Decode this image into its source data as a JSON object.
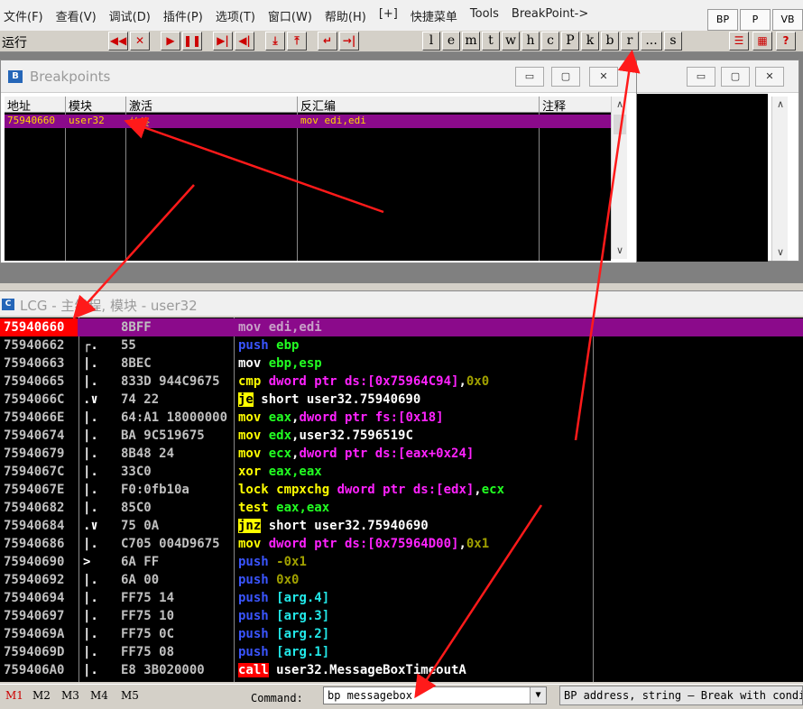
{
  "menu": [
    "文件(F)",
    "查看(V)",
    "调试(D)",
    "插件(P)",
    "选项(T)",
    "窗口(W)",
    "帮助(H)",
    "[+]",
    "快捷菜单",
    "Tools",
    "BreakPoint->"
  ],
  "top_buttons": [
    "BP",
    "P",
    "VB"
  ],
  "toolbar": {
    "status": "运行",
    "buttons": [
      "◀◀",
      "✕",
      "▶",
      "❚❚",
      "▶|",
      "◀|",
      "⤓",
      "⤒",
      "↵",
      "→|"
    ],
    "letters": [
      "l",
      "e",
      "m",
      "t",
      "w",
      "h",
      "c",
      "P",
      "k",
      "b",
      "r",
      "...",
      "s"
    ],
    "extra": [
      "☰",
      "▦",
      "?"
    ]
  },
  "breakpoints_window": {
    "title": "Breakpoints",
    "columns": [
      "地址",
      "模块",
      "激活",
      "反汇编",
      "注释"
    ],
    "rows": [
      {
        "address": "75940660",
        "module": "user32",
        "active": "始终",
        "disasm": "mov edi,edi",
        "comment": ""
      }
    ]
  },
  "cpu_window": {
    "title": "LCG - 主线程, 模块 - user32",
    "rows": [
      {
        "addr": "75940660",
        "mark": "",
        "hex": "8BFF",
        "parts": [
          {
            "t": "mov edi,edi",
            "c": "#ffffff"
          }
        ]
      },
      {
        "addr": "75940662",
        "mark": "┌.",
        "hex": "55",
        "parts": [
          {
            "t": "push ",
            "c": "#3a55ff"
          },
          {
            "t": "ebp",
            "c": "#22ff22"
          }
        ]
      },
      {
        "addr": "75940663",
        "mark": "|.",
        "hex": "8BEC",
        "parts": [
          {
            "t": "mov ",
            "c": "#ffffff"
          },
          {
            "t": "ebp,esp",
            "c": "#22ff22"
          }
        ]
      },
      {
        "addr": "75940665",
        "mark": "|.",
        "hex": "833D 944C9675",
        "parts": [
          {
            "t": "cmp ",
            "c": "#ffff00"
          },
          {
            "t": "dword ptr ds:[0x75964C94]",
            "c": "#ff22ff"
          },
          {
            "t": ",",
            "c": "#ffffff"
          },
          {
            "t": "0x0",
            "c": "#a0a000"
          }
        ]
      },
      {
        "addr": "7594066C",
        "mark": ".∨",
        "hex": "74 22",
        "parts": [
          {
            "t": "je",
            "c": "#000000",
            "bg": "#ffff00"
          },
          {
            "t": " short user32.75940690",
            "c": "#ffffff"
          }
        ]
      },
      {
        "addr": "7594066E",
        "mark": "|.",
        "hex": "64:A1 18000000",
        "parts": [
          {
            "t": "mov ",
            "c": "#ffff00"
          },
          {
            "t": "eax",
            "c": "#22ff22"
          },
          {
            "t": ",",
            "c": "#ffffff"
          },
          {
            "t": "dword ptr fs:[0x18]",
            "c": "#ff22ff"
          }
        ]
      },
      {
        "addr": "75940674",
        "mark": "|.",
        "hex": "BA 9C519675",
        "parts": [
          {
            "t": "mov ",
            "c": "#ffff00"
          },
          {
            "t": "edx",
            "c": "#22ff22"
          },
          {
            "t": ",user32.7596519C",
            "c": "#ffffff"
          }
        ]
      },
      {
        "addr": "75940679",
        "mark": "|.",
        "hex": "8B48 24",
        "parts": [
          {
            "t": "mov ",
            "c": "#ffff00"
          },
          {
            "t": "ecx",
            "c": "#22ff22"
          },
          {
            "t": ",",
            "c": "#ffffff"
          },
          {
            "t": "dword ptr ds:[eax+0x24]",
            "c": "#ff22ff"
          }
        ]
      },
      {
        "addr": "7594067C",
        "mark": "|.",
        "hex": "33C0",
        "parts": [
          {
            "t": "xor ",
            "c": "#ffff00"
          },
          {
            "t": "eax,eax",
            "c": "#22ff22"
          }
        ]
      },
      {
        "addr": "7594067E",
        "mark": "|.",
        "hex": "F0:0fb10a",
        "parts": [
          {
            "t": "lock cmpxchg ",
            "c": "#ffff00"
          },
          {
            "t": "dword ptr ds:[edx]",
            "c": "#ff22ff"
          },
          {
            "t": ",",
            "c": "#ffffff"
          },
          {
            "t": "ecx",
            "c": "#22ff22"
          }
        ]
      },
      {
        "addr": "75940682",
        "mark": "|.",
        "hex": "85C0",
        "parts": [
          {
            "t": "test ",
            "c": "#ffff00"
          },
          {
            "t": "eax,eax",
            "c": "#22ff22"
          }
        ]
      },
      {
        "addr": "75940684",
        "mark": ".∨",
        "hex": "75 0A",
        "parts": [
          {
            "t": "jnz",
            "c": "#000000",
            "bg": "#ffff00"
          },
          {
            "t": " short user32.75940690",
            "c": "#ffffff"
          }
        ]
      },
      {
        "addr": "75940686",
        "mark": "|.",
        "hex": "C705 004D9675",
        "parts": [
          {
            "t": "mov ",
            "c": "#ffff00"
          },
          {
            "t": "dword ptr ds:[0x75964D00]",
            "c": "#ff22ff"
          },
          {
            "t": ",",
            "c": "#ffffff"
          },
          {
            "t": "0x1",
            "c": "#a0a000"
          }
        ]
      },
      {
        "addr": "75940690",
        "mark": ">",
        "hex": "6A FF",
        "parts": [
          {
            "t": "push ",
            "c": "#3a55ff"
          },
          {
            "t": "-0x1",
            "c": "#a0a000"
          }
        ]
      },
      {
        "addr": "75940692",
        "mark": "|.",
        "hex": "6A 00",
        "parts": [
          {
            "t": "push ",
            "c": "#3a55ff"
          },
          {
            "t": "0x0",
            "c": "#a0a000"
          }
        ]
      },
      {
        "addr": "75940694",
        "mark": "|.",
        "hex": "FF75 14",
        "parts": [
          {
            "t": "push ",
            "c": "#3a55ff"
          },
          {
            "t": "[arg.4]",
            "c": "#22e8e8"
          }
        ]
      },
      {
        "addr": "75940697",
        "mark": "|.",
        "hex": "FF75 10",
        "parts": [
          {
            "t": "push ",
            "c": "#3a55ff"
          },
          {
            "t": "[arg.3]",
            "c": "#22e8e8"
          }
        ]
      },
      {
        "addr": "7594069A",
        "mark": "|.",
        "hex": "FF75 0C",
        "parts": [
          {
            "t": "push ",
            "c": "#3a55ff"
          },
          {
            "t": "[arg.2]",
            "c": "#22e8e8"
          }
        ]
      },
      {
        "addr": "7594069D",
        "mark": "|.",
        "hex": "FF75 08",
        "parts": [
          {
            "t": "push ",
            "c": "#3a55ff"
          },
          {
            "t": "[arg.1]",
            "c": "#22e8e8"
          }
        ]
      },
      {
        "addr": "759406A0",
        "mark": "|.",
        "hex": "E8 3B020000",
        "parts": [
          {
            "t": "call",
            "c": "#ffffff",
            "bg": "#ff0000"
          },
          {
            "t": " user32.MessageBoxTimeoutA",
            "c": "#ffffff"
          }
        ]
      }
    ]
  },
  "bottom": {
    "markers": [
      "M1",
      "M2",
      "M3",
      "M4",
      "M5"
    ],
    "command_label": "Command:",
    "command_value": "bp messagebox",
    "hint": "BP address, string — Break with condition"
  }
}
